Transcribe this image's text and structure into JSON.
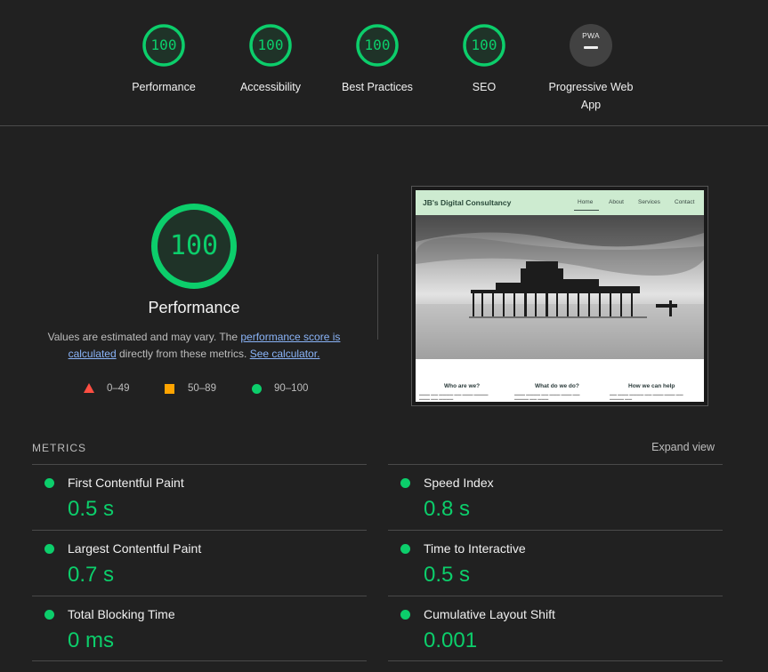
{
  "colors": {
    "pass": "#0cce6b",
    "average": "#ffa400",
    "fail": "#ff4e42",
    "link": "#8ab4f8",
    "background": "#212121"
  },
  "gauges": [
    {
      "label": "Performance",
      "score": "100"
    },
    {
      "label": "Accessibility",
      "score": "100"
    },
    {
      "label": "Best Practices",
      "score": "100"
    },
    {
      "label": "SEO",
      "score": "100"
    }
  ],
  "pwa": {
    "badge": "PWA",
    "label_line1": "Progressive Web",
    "label_line2": "App"
  },
  "main": {
    "score": "100",
    "title": "Performance",
    "desc_before": "Values are estimated and may vary. The ",
    "desc_link1": "performance score is calculated",
    "desc_middle": " directly from these metrics. ",
    "desc_link2": "See calculator."
  },
  "legend": {
    "fail": "0–49",
    "average": "50–89",
    "pass": "90–100"
  },
  "screenshot": {
    "brand": "JB's Digital Consultancy",
    "nav": [
      "Home",
      "About",
      "Services",
      "Contact"
    ],
    "sections": [
      "Who are we?",
      "What do we do?",
      "How we can help"
    ]
  },
  "metrics": {
    "header": "METRICS",
    "expand": "Expand view",
    "items": [
      {
        "name": "First Contentful Paint",
        "value": "0.5 s"
      },
      {
        "name": "Speed Index",
        "value": "0.8 s"
      },
      {
        "name": "Largest Contentful Paint",
        "value": "0.7 s"
      },
      {
        "name": "Time to Interactive",
        "value": "0.5 s"
      },
      {
        "name": "Total Blocking Time",
        "value": "0 ms"
      },
      {
        "name": "Cumulative Layout Shift",
        "value": "0.001"
      }
    ]
  }
}
